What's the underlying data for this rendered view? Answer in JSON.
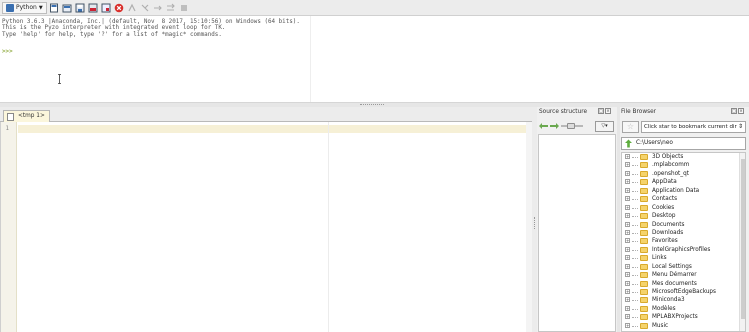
{
  "toolbar": {
    "shell_label": "Python",
    "icons": [
      "new-file-icon",
      "open-file-icon",
      "save-icon",
      "save-all-icon",
      "close-file-icon",
      "stop-icon",
      "run-file-icon",
      "run-selection-icon",
      "run-cell-icon",
      "run-cell-advance-icon",
      "interrupt-icon"
    ]
  },
  "shell": {
    "lines": [
      "Python 3.6.3 |Anaconda, Inc.| (default, Nov  8 2017, 15:10:56) on Windows (64 bits).",
      "This is the Pyzo interpreter with integrated event loop for TK.",
      "Type 'help' for help, type '?' for a list of *magic* commands."
    ],
    "prompt": ">>>"
  },
  "editor": {
    "tab_label": "<tmp 1>",
    "line_number": "1"
  },
  "source_structure": {
    "title": "Source structure",
    "dropdown": "▽▾"
  },
  "file_browser": {
    "title": "File Browser",
    "star": "☆",
    "bookmark_placeholder": "Click star to bookmark current dir",
    "path": "C:\\Users\\neo",
    "items": [
      "3D Objects",
      ".mplabcomm",
      ".openshot_qt",
      "AppData",
      "Application Data",
      "Contacts",
      "Cookies",
      "Desktop",
      "Documents",
      "Downloads",
      "Favorites",
      "IntelGraphicsProfiles",
      "Links",
      "Local Settings",
      "Menu Démarrer",
      "Mes documents",
      "MicrosoftEdgeBackups",
      "Miniconda3",
      "Modèles",
      "MPLABXProjects",
      "Music"
    ]
  },
  "colors": {
    "prompt": "#7a9a1a",
    "current_line": "#f6f0d6",
    "folder": "#f5d36b",
    "stop_button": "#d9302c"
  }
}
